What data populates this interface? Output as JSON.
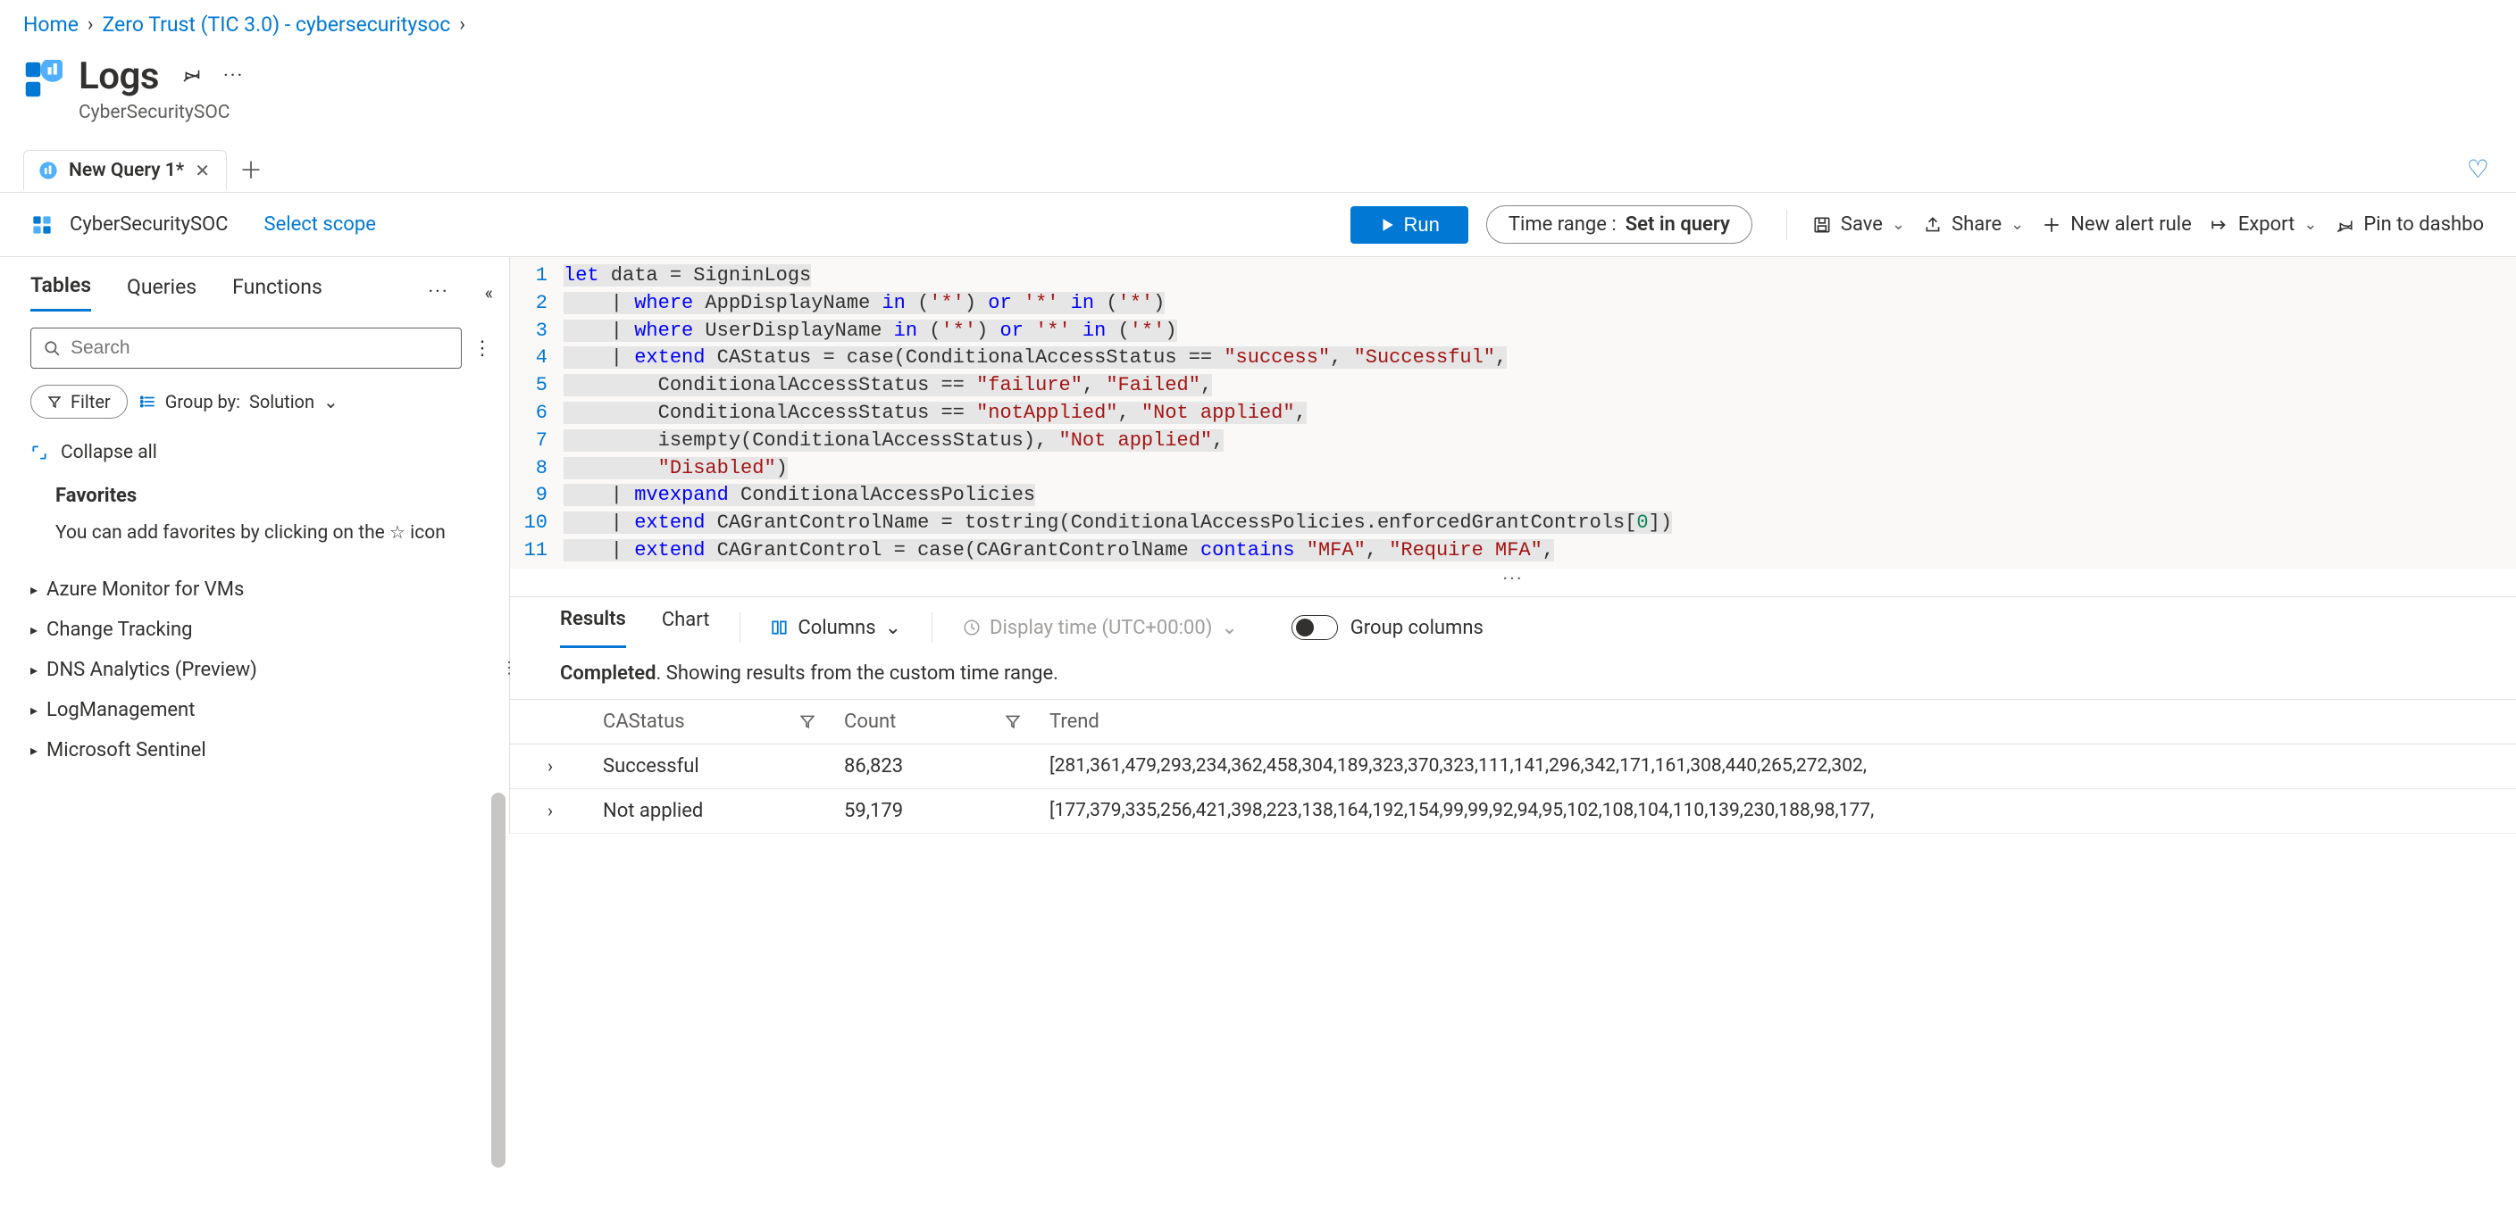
{
  "breadcrumb": {
    "home": "Home",
    "workbook": "Zero Trust (TIC 3.0) - cybersecuritysoc"
  },
  "blade": {
    "title": "Logs",
    "subtitle": "CyberSecuritySOC"
  },
  "tabs": {
    "query_tab_label": "New Query 1*",
    "add_tab_title": "New tab"
  },
  "context": {
    "workspace": "CyberSecuritySOC",
    "select_scope": "Select scope",
    "run": "Run",
    "time_range_label": "Time range :",
    "time_range_value": "Set in query",
    "save": "Save",
    "share": "Share",
    "new_alert": "New alert rule",
    "export": "Export",
    "pin": "Pin to dashbo"
  },
  "sidebar": {
    "tabs": {
      "tables": "Tables",
      "queries": "Queries",
      "functions": "Functions"
    },
    "search_placeholder": "Search",
    "filter": "Filter",
    "group_by_prefix": "Group by:",
    "group_by_value": "Solution",
    "collapse_all": "Collapse all",
    "favorites_title": "Favorites",
    "favorites_hint_before": "You can add favorites by clicking on the ",
    "favorites_hint_after": " icon",
    "items": [
      "Azure Monitor for VMs",
      "Change Tracking",
      "DNS Analytics (Preview)",
      "LogManagement",
      "Microsoft Sentinel"
    ]
  },
  "editor": {
    "lines": [
      {
        "n": 1,
        "segments": [
          {
            "t": "let",
            "c": "kw"
          },
          {
            "t": " data = SigninLogs"
          }
        ],
        "sel": true
      },
      {
        "n": 2,
        "segments": [
          {
            "t": "    | "
          },
          {
            "t": "where",
            "c": "kw"
          },
          {
            "t": " AppDisplayName "
          },
          {
            "t": "in",
            "c": "kw"
          },
          {
            "t": " ("
          },
          {
            "t": "'*'",
            "c": "str"
          },
          {
            "t": ") "
          },
          {
            "t": "or",
            "c": "kw"
          },
          {
            "t": " "
          },
          {
            "t": "'*'",
            "c": "str"
          },
          {
            "t": " "
          },
          {
            "t": "in",
            "c": "kw"
          },
          {
            "t": " ("
          },
          {
            "t": "'*'",
            "c": "str"
          },
          {
            "t": ")"
          }
        ],
        "sel": true
      },
      {
        "n": 3,
        "segments": [
          {
            "t": "    | "
          },
          {
            "t": "where",
            "c": "kw"
          },
          {
            "t": " UserDisplayName "
          },
          {
            "t": "in",
            "c": "kw"
          },
          {
            "t": " ("
          },
          {
            "t": "'*'",
            "c": "str"
          },
          {
            "t": ") "
          },
          {
            "t": "or",
            "c": "kw"
          },
          {
            "t": " "
          },
          {
            "t": "'*'",
            "c": "str"
          },
          {
            "t": " "
          },
          {
            "t": "in",
            "c": "kw"
          },
          {
            "t": " ("
          },
          {
            "t": "'*'",
            "c": "str"
          },
          {
            "t": ")"
          }
        ],
        "sel": true
      },
      {
        "n": 4,
        "segments": [
          {
            "t": "    | "
          },
          {
            "t": "extend",
            "c": "kw"
          },
          {
            "t": " CAStatus = case(ConditionalAccessStatus == "
          },
          {
            "t": "\"success\"",
            "c": "str"
          },
          {
            "t": ", "
          },
          {
            "t": "\"Successful\"",
            "c": "str"
          },
          {
            "t": ","
          }
        ],
        "sel": true
      },
      {
        "n": 5,
        "segments": [
          {
            "t": "        ConditionalAccessStatus == "
          },
          {
            "t": "\"failure\"",
            "c": "str"
          },
          {
            "t": ", "
          },
          {
            "t": "\"Failed\"",
            "c": "str"
          },
          {
            "t": ","
          }
        ],
        "sel": true
      },
      {
        "n": 6,
        "segments": [
          {
            "t": "        ConditionalAccessStatus == "
          },
          {
            "t": "\"notApplied\"",
            "c": "str"
          },
          {
            "t": ", "
          },
          {
            "t": "\"Not applied\"",
            "c": "str"
          },
          {
            "t": ","
          }
        ],
        "sel": true
      },
      {
        "n": 7,
        "segments": [
          {
            "t": "        isempty(ConditionalAccessStatus), "
          },
          {
            "t": "\"Not applied\"",
            "c": "str"
          },
          {
            "t": ","
          }
        ],
        "sel": true
      },
      {
        "n": 8,
        "segments": [
          {
            "t": "        "
          },
          {
            "t": "\"Disabled\"",
            "c": "str"
          },
          {
            "t": ")"
          }
        ],
        "sel": true
      },
      {
        "n": 9,
        "segments": [
          {
            "t": "    | "
          },
          {
            "t": "mvexpand",
            "c": "kw"
          },
          {
            "t": " ConditionalAccessPolicies"
          }
        ],
        "sel": true
      },
      {
        "n": 10,
        "segments": [
          {
            "t": "    | "
          },
          {
            "t": "extend",
            "c": "kw"
          },
          {
            "t": " CAGrantControlName = tostring(ConditionalAccessPolicies.enforcedGrantControls["
          },
          {
            "t": "0",
            "c": "num"
          },
          {
            "t": "])"
          }
        ],
        "sel": true
      },
      {
        "n": 11,
        "segments": [
          {
            "t": "    | "
          },
          {
            "t": "extend",
            "c": "kw"
          },
          {
            "t": " CAGrantControl = case(CAGrantControlName "
          },
          {
            "t": "contains",
            "c": "kw"
          },
          {
            "t": " "
          },
          {
            "t": "\"MFA\"",
            "c": "str"
          },
          {
            "t": ", "
          },
          {
            "t": "\"Require MFA\"",
            "c": "str"
          },
          {
            "t": ","
          }
        ],
        "sel": true
      }
    ]
  },
  "results": {
    "tabs": {
      "results": "Results",
      "chart": "Chart"
    },
    "columns_label": "Columns",
    "display_time": "Display time (UTC+00:00)",
    "group_columns": "Group columns",
    "status_prefix": "Completed",
    "status_rest": ". Showing results from the custom time range.",
    "headers": {
      "castatus": "CAStatus",
      "count": "Count",
      "trend": "Trend"
    },
    "rows": [
      {
        "status": "Successful",
        "count": "86,823",
        "trend": "[281,361,479,293,234,362,458,304,189,323,370,323,111,141,296,342,171,161,308,440,265,272,302,"
      },
      {
        "status": "Not applied",
        "count": "59,179",
        "trend": "[177,379,335,256,421,398,223,138,164,192,154,99,99,92,94,95,102,108,104,110,139,230,188,98,177,"
      }
    ]
  },
  "chart_data": [
    {
      "type": "line",
      "name": "Successful",
      "values": [
        281,
        361,
        479,
        293,
        234,
        362,
        458,
        304,
        189,
        323,
        370,
        323,
        111,
        141,
        296,
        342,
        171,
        161,
        308,
        440,
        265,
        272,
        302
      ]
    },
    {
      "type": "line",
      "name": "Not applied",
      "values": [
        177,
        379,
        335,
        256,
        421,
        398,
        223,
        138,
        164,
        192,
        154,
        99,
        99,
        92,
        94,
        95,
        102,
        108,
        104,
        110,
        139,
        230,
        188,
        98,
        177
      ]
    }
  ]
}
